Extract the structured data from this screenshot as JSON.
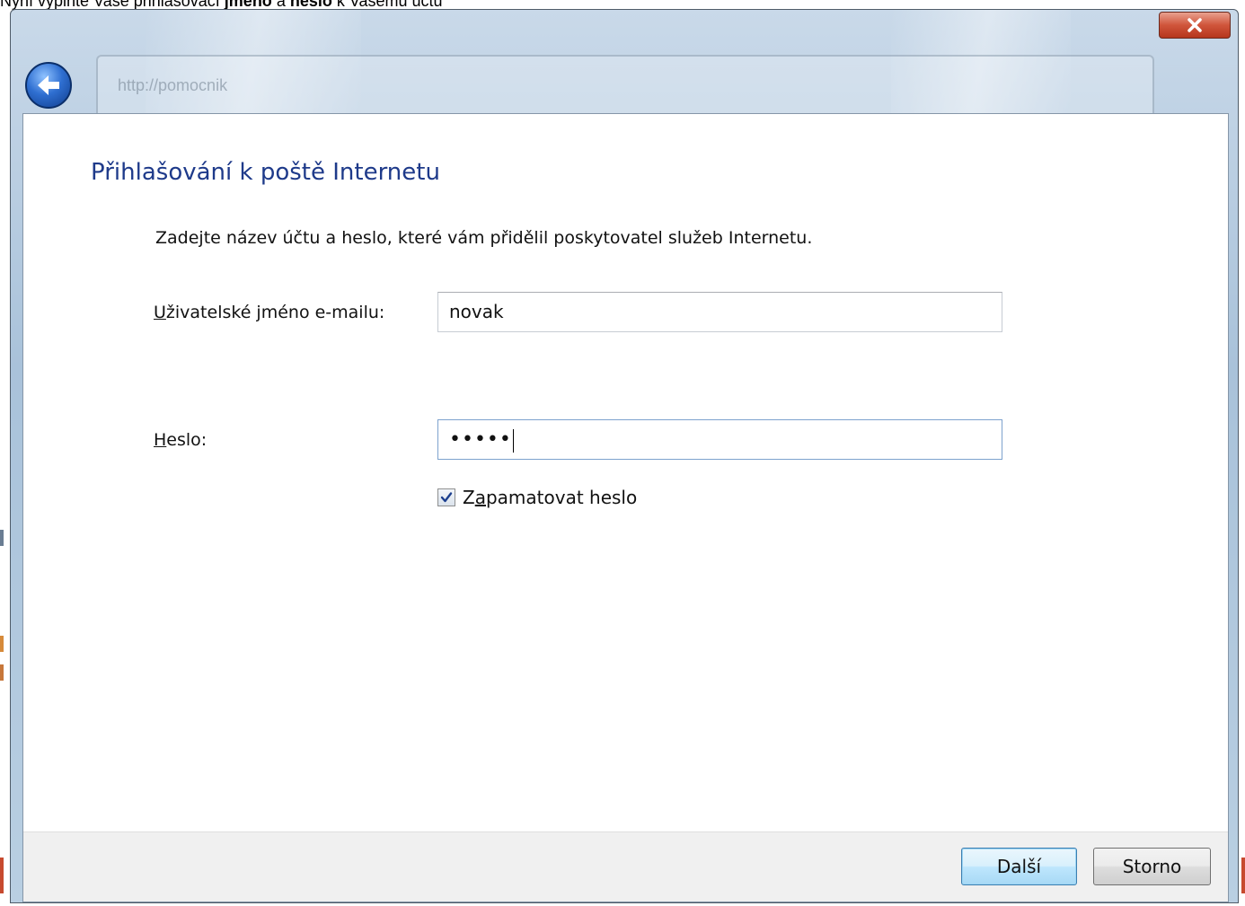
{
  "caption": {
    "part1": "Nyní vyplňte Vaše přihlašovací ",
    "bold1": "jméno",
    "part2": " a ",
    "bold2": "heslo",
    "part3": " k Vašemu účtu"
  },
  "window": {
    "close_label": "x",
    "address_text": "http://pomocnik"
  },
  "page": {
    "title": "Přihlašování k poště Internetu",
    "instruction": "Zadejte název účtu a heslo, které vám přidělil poskytovatel služeb Internetu."
  },
  "form": {
    "username_label_mn": "U",
    "username_label_rest": "živatelské jméno e-mailu:",
    "username_value": "novak",
    "password_label_mn": "H",
    "password_label_rest": "eslo:",
    "password_value": "•••••",
    "remember_label_pre": "Z",
    "remember_label_mn": "a",
    "remember_label_rest": "pamatovat heslo",
    "remember_checked": true
  },
  "footer": {
    "next_label": "Další",
    "cancel_label": "Storno"
  },
  "colors": {
    "title": "#1e3a8a",
    "close_button": "#d0553b",
    "default_button_border": "#3c7fb1"
  },
  "icons": {
    "back": "back-arrow-icon",
    "close": "close-icon",
    "checkbox": "checkmark-icon"
  }
}
